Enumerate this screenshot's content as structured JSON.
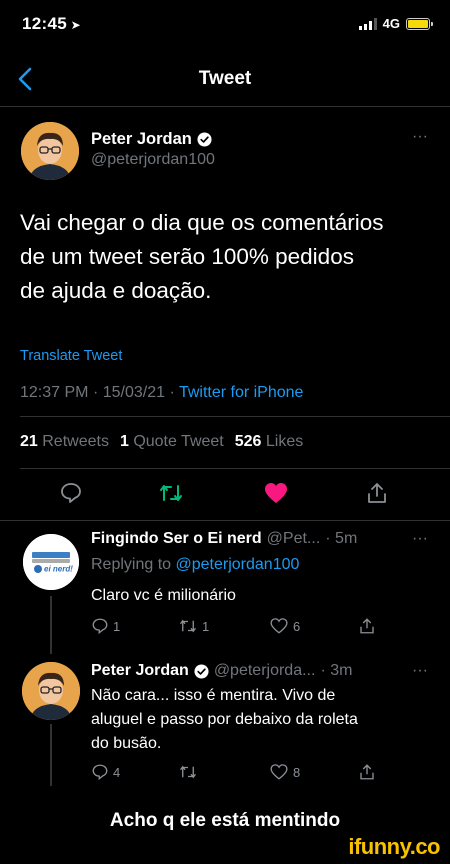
{
  "status": {
    "time": "12:45",
    "network": "4G"
  },
  "header": {
    "title": "Tweet"
  },
  "tweet": {
    "author": {
      "name": "Peter Jordan",
      "handle": "@peterjordan100"
    },
    "more": "···",
    "text_lines": [
      "Vai chegar o dia que os comentários",
      "de um tweet serão 100% pedidos",
      "de ajuda e doação."
    ],
    "translate": "Translate Tweet",
    "time": "12:37 PM",
    "date": "15/03/21",
    "source": "Twitter for iPhone",
    "stats": {
      "retweets_count": "21",
      "retweets_label": "Retweets",
      "quotes_count": "1",
      "quotes_label": "Quote Tweet",
      "likes_count": "526",
      "likes_label": "Likes"
    }
  },
  "replies": [
    {
      "name": "Fingindo Ser o Ei nerd",
      "handle": "@Pet...",
      "age": "· 5m",
      "replying_prefix": "Replying to ",
      "replying_to": "@peterjordan100",
      "text_lines": [
        "Claro vc é milionário"
      ],
      "avatar_text": "ei nerd!",
      "counts": {
        "reply": "1",
        "retweet": "1",
        "like": "6"
      }
    },
    {
      "name": "Peter Jordan",
      "handle": "@peterjorda...",
      "age": "· 3m",
      "text_lines": [
        "Não cara... isso é mentira. Vivo de",
        "aluguel e passo por debaixo da roleta",
        "do busão."
      ],
      "counts": {
        "reply": "4",
        "retweet": "",
        "like": "8"
      }
    }
  ],
  "caption": "Acho q ele está mentindo",
  "watermark": "ifunny.co",
  "colors": {
    "accent": "#1d9bf0",
    "like": "#f91880",
    "retweet": "#00ba7c",
    "battery": "#f5d90a"
  }
}
